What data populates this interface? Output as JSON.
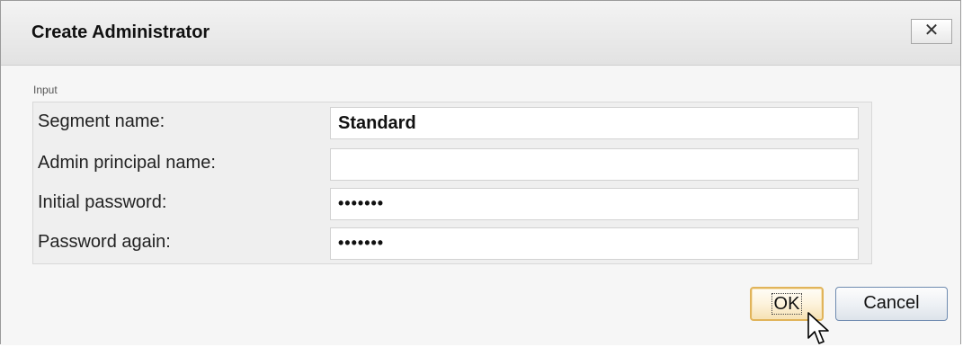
{
  "dialog": {
    "title": "Create Administrator",
    "close_icon": "close-icon",
    "close_glyph": "✕"
  },
  "group": {
    "label": "Input",
    "rows": [
      {
        "label": "Segment name:",
        "value": "Standard",
        "type": "text"
      },
      {
        "label": "Admin principal name:",
        "value": "",
        "type": "text"
      },
      {
        "label": "Initial password:",
        "value": "•••••••",
        "type": "password"
      },
      {
        "label": "Password again:",
        "value": "•••••••",
        "type": "password"
      }
    ]
  },
  "buttons": {
    "ok_label": "OK",
    "cancel_label": "Cancel"
  },
  "cursor_icon": "mouse-pointer-icon"
}
